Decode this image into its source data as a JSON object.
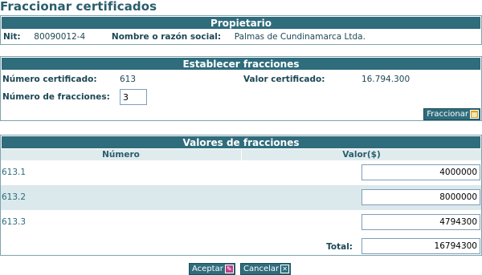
{
  "page": {
    "title": "Fraccionar certificados"
  },
  "propietario": {
    "header": "Propietario",
    "nit_label": "Nit:",
    "nit_value": "80090012-4",
    "nombre_label": "Nombre o razón social:",
    "nombre_value": "Palmas de Cundinamarca Ltda."
  },
  "establecer": {
    "header": "Establecer fracciones",
    "numero_cert_label": "Número certificado:",
    "numero_cert_value": "613",
    "valor_cert_label": "Valor certificado:",
    "valor_cert_value": "16.794.300",
    "num_fracciones_label": "Número de fracciones:",
    "num_fracciones_value": "3",
    "fraccionar_button": "Fraccionar"
  },
  "valores": {
    "header": "Valores de fracciones",
    "col_numero": "Número",
    "col_valor": "Valor($)",
    "rows": [
      {
        "numero": "613.1",
        "valor": "4000000"
      },
      {
        "numero": "613.2",
        "valor": "8000000"
      },
      {
        "numero": "613.3",
        "valor": "4794300"
      }
    ],
    "total_label": "Total:",
    "total_value": "16794300"
  },
  "actions": {
    "aceptar": "Aceptar",
    "cancelar": "Cancelar"
  },
  "colors": {
    "header_bg": "#2f6c7c",
    "alt_row": "#dbe8ec",
    "text": "#1d4755"
  }
}
